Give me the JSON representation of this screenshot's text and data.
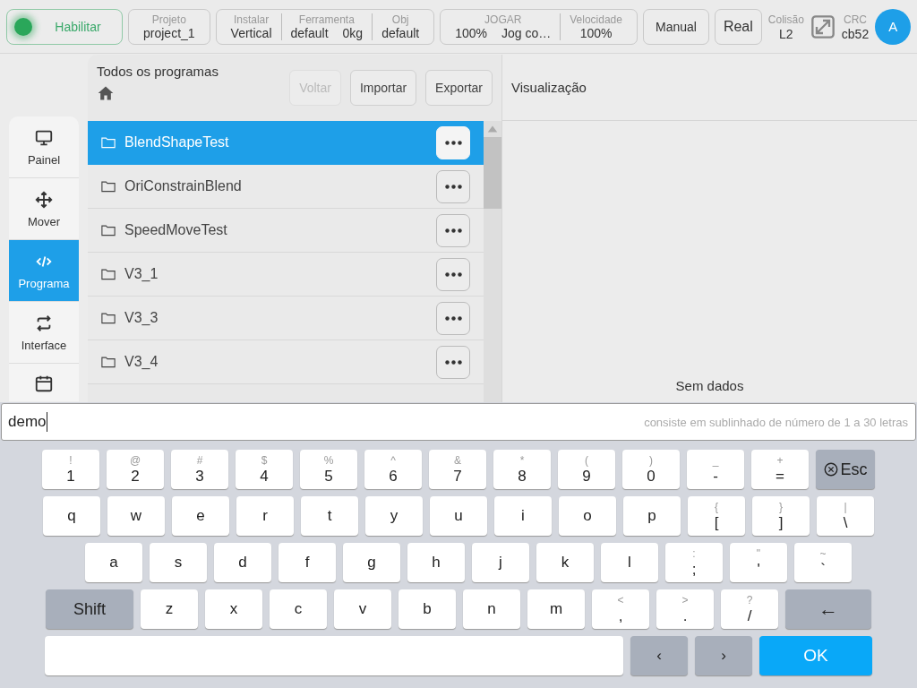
{
  "top_bar": {
    "enable_button": {
      "label": "Habilitar",
      "on": true
    },
    "groups": [
      {
        "fields": [
          {
            "title": "Projeto",
            "values": [
              "project_1"
            ]
          }
        ]
      },
      {
        "fields": [
          {
            "title": "Instalar",
            "values": [
              "Vertical"
            ]
          },
          {
            "title": "Ferramenta",
            "values": [
              "default",
              "0kg"
            ]
          },
          {
            "title": "Obj",
            "values": [
              "default"
            ]
          }
        ]
      },
      {
        "fields": [
          {
            "title": "JOGAR",
            "values": [
              "100%",
              "Jog co…"
            ]
          },
          {
            "title": "Velocidade",
            "values": [
              "100%"
            ]
          }
        ]
      }
    ],
    "mode_buttons": [
      "Manual",
      "Real"
    ],
    "collision": {
      "title": "Colisão",
      "value": "L2"
    },
    "crc": {
      "title": "CRC",
      "value": "cb52"
    },
    "avatar": "A"
  },
  "sidebar": {
    "items": [
      {
        "label": "Painel",
        "selected": false
      },
      {
        "label": "Mover",
        "selected": false
      },
      {
        "label": "Programa",
        "selected": true
      },
      {
        "label": "Interface",
        "selected": false
      },
      {
        "selected": false
      }
    ]
  },
  "programs": {
    "title": "Todos os programas",
    "buttons": [
      {
        "label": "Voltar",
        "disabled": true
      },
      {
        "label": "Importar",
        "disabled": false
      },
      {
        "label": "Exportar",
        "disabled": false
      }
    ],
    "items": [
      {
        "name": "BlendShapeTest",
        "selected": true
      },
      {
        "name": "OriConstrainBlend",
        "selected": false
      },
      {
        "name": "SpeedMoveTest",
        "selected": false
      },
      {
        "name": "V3_1",
        "selected": false
      },
      {
        "name": "V3_3",
        "selected": false
      },
      {
        "name": "V3_4",
        "selected": false
      }
    ]
  },
  "preview": {
    "title": "Visualização",
    "empty_text": "Sem dados"
  },
  "input": {
    "value": "demo",
    "hint": "consiste em sublinhado de número de 1 a 30 letras"
  },
  "keyboard": {
    "rows": [
      [
        {
          "kind": "char",
          "label": "1",
          "shift": "!"
        },
        {
          "kind": "char",
          "label": "2",
          "shift": "@"
        },
        {
          "kind": "char",
          "label": "3",
          "shift": "#"
        },
        {
          "kind": "char",
          "label": "4",
          "shift": "$"
        },
        {
          "kind": "char",
          "label": "5",
          "shift": "%"
        },
        {
          "kind": "char",
          "label": "6",
          "shift": "^"
        },
        {
          "kind": "char",
          "label": "7",
          "shift": "&"
        },
        {
          "kind": "char",
          "label": "8",
          "shift": "*"
        },
        {
          "kind": "char",
          "label": "9",
          "shift": "("
        },
        {
          "kind": "char",
          "label": "0",
          "shift": ")"
        },
        {
          "kind": "char",
          "label": "-",
          "shift": "_"
        },
        {
          "kind": "char",
          "label": "=",
          "shift": "+"
        },
        {
          "kind": "esc",
          "label": "Esc"
        }
      ],
      [
        {
          "kind": "char",
          "label": "q"
        },
        {
          "kind": "char",
          "label": "w"
        },
        {
          "kind": "char",
          "label": "e"
        },
        {
          "kind": "char",
          "label": "r"
        },
        {
          "kind": "char",
          "label": "t"
        },
        {
          "kind": "char",
          "label": "y"
        },
        {
          "kind": "char",
          "label": "u"
        },
        {
          "kind": "char",
          "label": "i"
        },
        {
          "kind": "char",
          "label": "o"
        },
        {
          "kind": "char",
          "label": "p"
        },
        {
          "kind": "char",
          "label": "[",
          "shift": "{"
        },
        {
          "kind": "char",
          "label": "]",
          "shift": "}"
        },
        {
          "kind": "char",
          "label": "\\",
          "shift": "|"
        }
      ],
      [
        {
          "kind": "char",
          "label": "a"
        },
        {
          "kind": "char",
          "label": "s"
        },
        {
          "kind": "char",
          "label": "d"
        },
        {
          "kind": "char",
          "label": "f"
        },
        {
          "kind": "char",
          "label": "g"
        },
        {
          "kind": "char",
          "label": "h"
        },
        {
          "kind": "char",
          "label": "j"
        },
        {
          "kind": "char",
          "label": "k"
        },
        {
          "kind": "char",
          "label": "l"
        },
        {
          "kind": "char",
          "label": ";",
          "shift": ":"
        },
        {
          "kind": "char",
          "label": "'",
          "shift": "\""
        },
        {
          "kind": "char",
          "label": "`",
          "shift": "~"
        }
      ],
      [
        {
          "kind": "shift",
          "label": "Shift"
        },
        {
          "kind": "char",
          "label": "z"
        },
        {
          "kind": "char",
          "label": "x"
        },
        {
          "kind": "char",
          "label": "c"
        },
        {
          "kind": "char",
          "label": "v"
        },
        {
          "kind": "char",
          "label": "b"
        },
        {
          "kind": "char",
          "label": "n"
        },
        {
          "kind": "char",
          "label": "m"
        },
        {
          "kind": "char",
          "label": ",",
          "shift": "<"
        },
        {
          "kind": "char",
          "label": ".",
          "shift": ">"
        },
        {
          "kind": "char",
          "label": "/",
          "shift": "?"
        },
        {
          "kind": "backspace",
          "label": "←"
        }
      ],
      [
        {
          "kind": "space"
        },
        {
          "kind": "arrow",
          "label": "‹"
        },
        {
          "kind": "arrow",
          "label": "›"
        },
        {
          "kind": "ok",
          "label": "OK"
        }
      ]
    ]
  }
}
